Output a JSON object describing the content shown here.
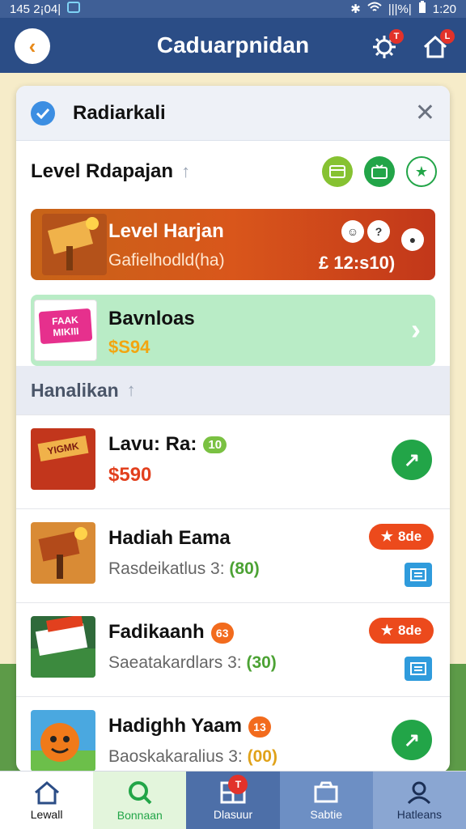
{
  "status_bar": {
    "time_left": "145 2¡04|",
    "time_right": "1:20",
    "signal_text": "|||%|"
  },
  "header": {
    "title": "Caduarpnidan",
    "settings_badge": "T",
    "home_badge": "L"
  },
  "panel": {
    "title": "Radiarkali",
    "section_title": "Level Rdapajan",
    "banner_orange": {
      "title": "Level Harjan",
      "subtitle": "Gafielhodld(ha)",
      "price": "£ 12:s10)"
    },
    "banner_green": {
      "title": "Bavnloas",
      "price": "$S94",
      "thumb_text": "FAAK MIKIII"
    },
    "list_header": "Hanalikan",
    "items": [
      {
        "title": "Lavu: Ra:",
        "tag": "10",
        "price": "$590",
        "thumb_text": "YIGMK"
      },
      {
        "title": "Hadiah Eama",
        "subtitle": "Rasdeikatlus 3:",
        "count": "(80)",
        "rating": "8de"
      },
      {
        "title": "Fadikaanh",
        "tag": "63",
        "subtitle": "Saeatakardlars 3:",
        "count": "(30)",
        "rating": "8de"
      },
      {
        "title": "Hadighh Yaam",
        "tag": "13",
        "subtitle": "Baoskakaralius 3:",
        "count": "(00)"
      }
    ]
  },
  "bottom_nav": {
    "items": [
      {
        "label": "Lewall"
      },
      {
        "label": "Bonnaan"
      },
      {
        "label": "Dlasuur",
        "badge": "T"
      },
      {
        "label": "Sabtie"
      },
      {
        "label": "Hatleans"
      }
    ]
  },
  "colors": {
    "header": "#2b4d86",
    "accent_green": "#22a548",
    "accent_orange": "#ec4a1c"
  }
}
